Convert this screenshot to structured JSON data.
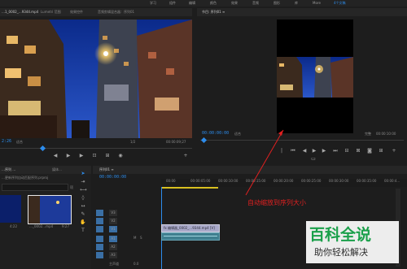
{
  "menubar": {
    "items": [
      "学习",
      "组件",
      "编辑",
      "颜色",
      "效果",
      "音频",
      "图形",
      "库",
      "More"
    ],
    "active_item": "4个文稿"
  },
  "source_panel": {
    "tabs": [
      "…1_0002_…9344.mp4",
      "Lumetri 范围",
      "效果控件",
      "音频剪辑混合器：序列01"
    ],
    "timecode_left": "2:26",
    "fit_label": "适合",
    "fraction": "1/2",
    "timecode_right": "00:00:09;27"
  },
  "program_panel": {
    "title": "节目: 序列01 ≡",
    "timecode_left": "00:00:00:00",
    "fit_label": "适合",
    "quality": "完整",
    "timecode_right": "00:00:10:00"
  },
  "project_panel": {
    "tabs": [
      "…序列 …",
      "媒体…"
    ],
    "path": "…更新序列自动匹配序列.prproj",
    "count": "项",
    "thumbnails": [
      {
        "duration": "4:22",
        "name": ""
      },
      {
        "duration": "9:27",
        "name": "…_0002…mp4"
      }
    ]
  },
  "timeline": {
    "title": "序列01 ≡",
    "timecode": "00:00:00:00",
    "ruler_labels": [
      "00:00",
      "00:00:05:00",
      "00:00:10:00",
      "00:00:15:00",
      "00:00:20:00",
      "00:00:25:00",
      "00:00:30:00",
      "00:00:35:00",
      "00:00:4…"
    ],
    "tracks": [
      "V3",
      "V2",
      "V1",
      "A1",
      "A2",
      "A3"
    ],
    "clip_video_label": "fx 编辑器_0002_…9344.mp4 [V]",
    "master_label": "主声道",
    "master_value": "0.0",
    "audio_letters": [
      "M",
      "S"
    ]
  },
  "annotation": {
    "text": "自动缩放到序列大小"
  },
  "watermark": {
    "brand": "百科全说",
    "slogan": "助你轻松解决"
  },
  "colors": {
    "accent_blue": "#2d8ceb",
    "annotation_red": "#e02020",
    "track_blue": "#3a6fa5",
    "watermark_green": "#1aa04a"
  }
}
